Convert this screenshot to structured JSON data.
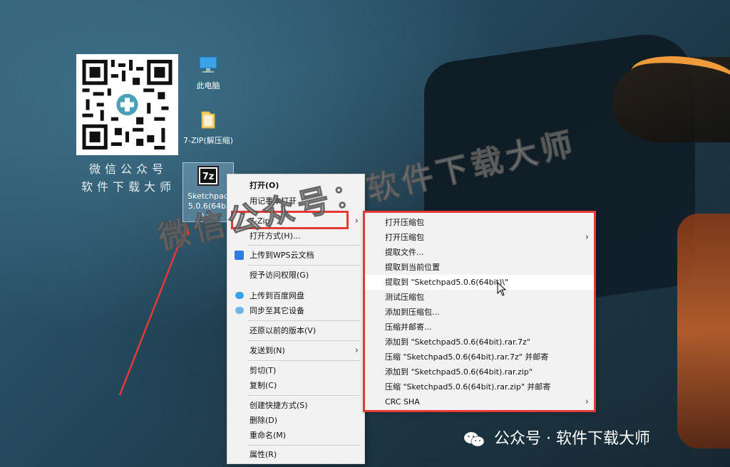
{
  "qr": {
    "caption_line1": "微信公众号",
    "caption_line2": "软件下载大师"
  },
  "desktop": {
    "icons": [
      {
        "label": "此电脑"
      },
      {
        "label": "7-ZIP(解压缩)"
      },
      {
        "label": "Sketchpad5.0.6(64bit).rar",
        "badge": "7z"
      }
    ]
  },
  "main_menu": {
    "items": [
      {
        "label": "打开(O)"
      },
      {
        "label": "用记事本打开"
      },
      {
        "label": "7-Zip"
      },
      {
        "label": "打开方式(H)..."
      },
      {
        "label": "上传到WPS云文档"
      },
      {
        "label": "授予访问权限(G)"
      },
      {
        "label": "上传到百度网盘"
      },
      {
        "label": "同步至其它设备"
      },
      {
        "label": "还原以前的版本(V)"
      },
      {
        "label": "发送到(N)"
      },
      {
        "label": "剪切(T)"
      },
      {
        "label": "复制(C)"
      },
      {
        "label": "创建快捷方式(S)"
      },
      {
        "label": "删除(D)"
      },
      {
        "label": "重命名(M)"
      },
      {
        "label": "属性(R)"
      }
    ]
  },
  "sub_menu": {
    "items": [
      {
        "label": "打开压缩包"
      },
      {
        "label": "打开压缩包"
      },
      {
        "label": "提取文件..."
      },
      {
        "label": "提取到当前位置"
      },
      {
        "label": "提取到 \"Sketchpad5.0.6(64bit)\\\""
      },
      {
        "label": "测试压缩包"
      },
      {
        "label": "添加到压缩包..."
      },
      {
        "label": "压缩并邮寄..."
      },
      {
        "label": "添加到 \"Sketchpad5.0.6(64bit).rar.7z\""
      },
      {
        "label": "压缩 \"Sketchpad5.0.6(64bit).rar.7z\" 并邮寄"
      },
      {
        "label": "添加到 \"Sketchpad5.0.6(64bit).rar.zip\""
      },
      {
        "label": "压缩 \"Sketchpad5.0.6(64bit).rar.zip\" 并邮寄"
      },
      {
        "label": "CRC SHA"
      }
    ]
  },
  "watermark": {
    "diagonal": "微信公众号：软件下载大师",
    "bottom": "公众号 · 软件下载大师"
  },
  "colors": {
    "highlight_red": "#e53935",
    "menu_bg": "#f2f2f2"
  }
}
